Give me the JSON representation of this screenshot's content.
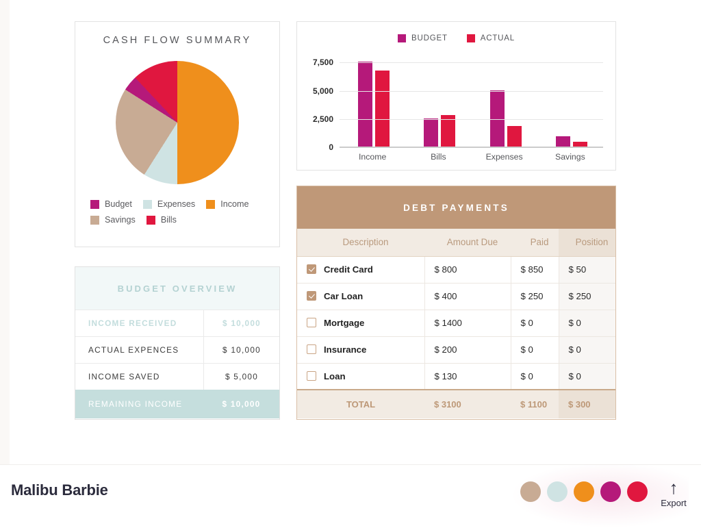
{
  "pie_card": {
    "title": "CASH FLOW SUMMARY",
    "legend": [
      {
        "label": "Budget",
        "color": "#b5197a"
      },
      {
        "label": "Expenses",
        "color": "#cfe3e3"
      },
      {
        "label": "Income",
        "color": "#ef8f1c"
      },
      {
        "label": "Savings",
        "color": "#c8ab94"
      },
      {
        "label": "Bills",
        "color": "#e0173f"
      }
    ]
  },
  "bar_card": {
    "legend": [
      {
        "label": "BUDGET",
        "color": "#b5197a"
      },
      {
        "label": "ACTUAL",
        "color": "#e0173f"
      }
    ]
  },
  "budget_overview": {
    "title": "BUDGET OVERVIEW",
    "rows": [
      {
        "label": "INCOME RECEIVED",
        "value": "$ 10,000",
        "style": "muted"
      },
      {
        "label": "ACTUAL EXPENCES",
        "value": "$ 10,000",
        "style": "normal"
      },
      {
        "label": "INCOME SAVED",
        "value": "$ 5,000",
        "style": "normal"
      }
    ],
    "total": {
      "label": "REMAINING INCOME",
      "value": "$ 10,000"
    }
  },
  "debt_payments": {
    "title": "DEBT PAYMENTS",
    "columns": [
      "Description",
      "Amount Due",
      "Paid",
      "Position"
    ],
    "rows": [
      {
        "checked": true,
        "description": "Credit Card",
        "amount_due": "$ 800",
        "paid": "$ 850",
        "position": "$ 50"
      },
      {
        "checked": true,
        "description": "Car Loan",
        "amount_due": "$ 400",
        "paid": "$ 250",
        "position": "$ 250"
      },
      {
        "checked": false,
        "description": "Mortgage",
        "amount_due": "$ 1400",
        "paid": "$ 0",
        "position": "$ 0"
      },
      {
        "checked": false,
        "description": "Insurance",
        "amount_due": "$ 200",
        "paid": "$ 0",
        "position": "$ 0"
      },
      {
        "checked": false,
        "description": "Loan",
        "amount_due": "$ 130",
        "paid": "$ 0",
        "position": "$ 0"
      }
    ],
    "total": {
      "label": "TOTAL",
      "amount_due": "$ 3100",
      "paid": "$ 1100",
      "position": "$ 300"
    }
  },
  "footer": {
    "brand": "Malibu Barbie",
    "swatches": [
      "#c8ab94",
      "#cfe3e3",
      "#ef8f1c",
      "#b5197a",
      "#e0173f"
    ],
    "export_label": "Export",
    "export_icon": "arrow-up-icon"
  },
  "chart_data": [
    {
      "type": "pie",
      "title": "CASH FLOW SUMMARY",
      "labels": [
        "Income",
        "Expenses",
        "Savings",
        "Budget",
        "Bills"
      ],
      "values": [
        50,
        9,
        25,
        4,
        12
      ],
      "colors": [
        "#ef8f1c",
        "#cfe3e3",
        "#c8ab94",
        "#b5197a",
        "#e0173f"
      ],
      "legend_position": "bottom",
      "start_angle_deg": 0,
      "direction": "clockwise"
    },
    {
      "type": "bar",
      "title": "",
      "categories": [
        "Income",
        "Bills",
        "Expenses",
        "Savings"
      ],
      "series": [
        {
          "name": "BUDGET",
          "color": "#b5197a",
          "values": [
            7500,
            2500,
            5000,
            900
          ]
        },
        {
          "name": "ACTUAL",
          "color": "#e0173f",
          "values": [
            6750,
            2800,
            1800,
            450
          ]
        }
      ],
      "ylabel": "",
      "xlabel": "",
      "ylim": [
        0,
        8500
      ],
      "yticks": [
        0,
        2500,
        5000,
        7500
      ],
      "ytick_labels": [
        "0",
        "2,500",
        "5,000",
        "7,500"
      ],
      "grid": true,
      "legend_position": "top"
    }
  ]
}
